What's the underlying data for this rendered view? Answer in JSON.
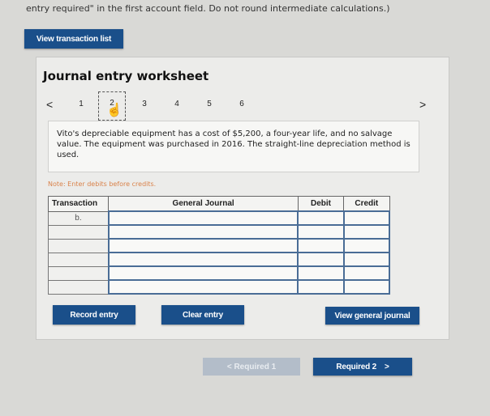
{
  "instruction_text": "entry required\" in the first account field. Do not round intermediate calculations.)",
  "view_transaction_list_label": "View transaction list",
  "worksheet": {
    "title": "Journal entry worksheet",
    "pager": {
      "prev_symbol": "<",
      "next_symbol": ">",
      "pages": [
        "1",
        "2",
        "3",
        "4",
        "5",
        "6"
      ],
      "active_page": "2"
    },
    "info_text": "Vito's depreciable equipment has a cost of $5,200, a four-year life, and no salvage value. The equipment was purchased in 2016. The straight-line depreciation method is used.",
    "note": "Note: Enter debits before credits.",
    "table": {
      "headers": {
        "transaction": "Transaction",
        "general_journal": "General Journal",
        "debit": "Debit",
        "credit": "Credit"
      },
      "rows": [
        {
          "transaction": "b.",
          "account": "",
          "debit": "",
          "credit": ""
        },
        {
          "transaction": "",
          "account": "",
          "debit": "",
          "credit": ""
        },
        {
          "transaction": "",
          "account": "",
          "debit": "",
          "credit": ""
        },
        {
          "transaction": "",
          "account": "",
          "debit": "",
          "credit": ""
        },
        {
          "transaction": "",
          "account": "",
          "debit": "",
          "credit": ""
        },
        {
          "transaction": "",
          "account": "",
          "debit": "",
          "credit": ""
        }
      ]
    },
    "buttons": {
      "record": "Record entry",
      "clear": "Clear entry",
      "view_general_journal": "View general journal"
    }
  },
  "nav": {
    "prev_label": "< Required 1",
    "next_label": "Required 2",
    "next_symbol": ">"
  },
  "colors": {
    "primary_button": "#1a4f8a",
    "disabled_button": "#b3bdc9",
    "note": "#d9824a"
  }
}
